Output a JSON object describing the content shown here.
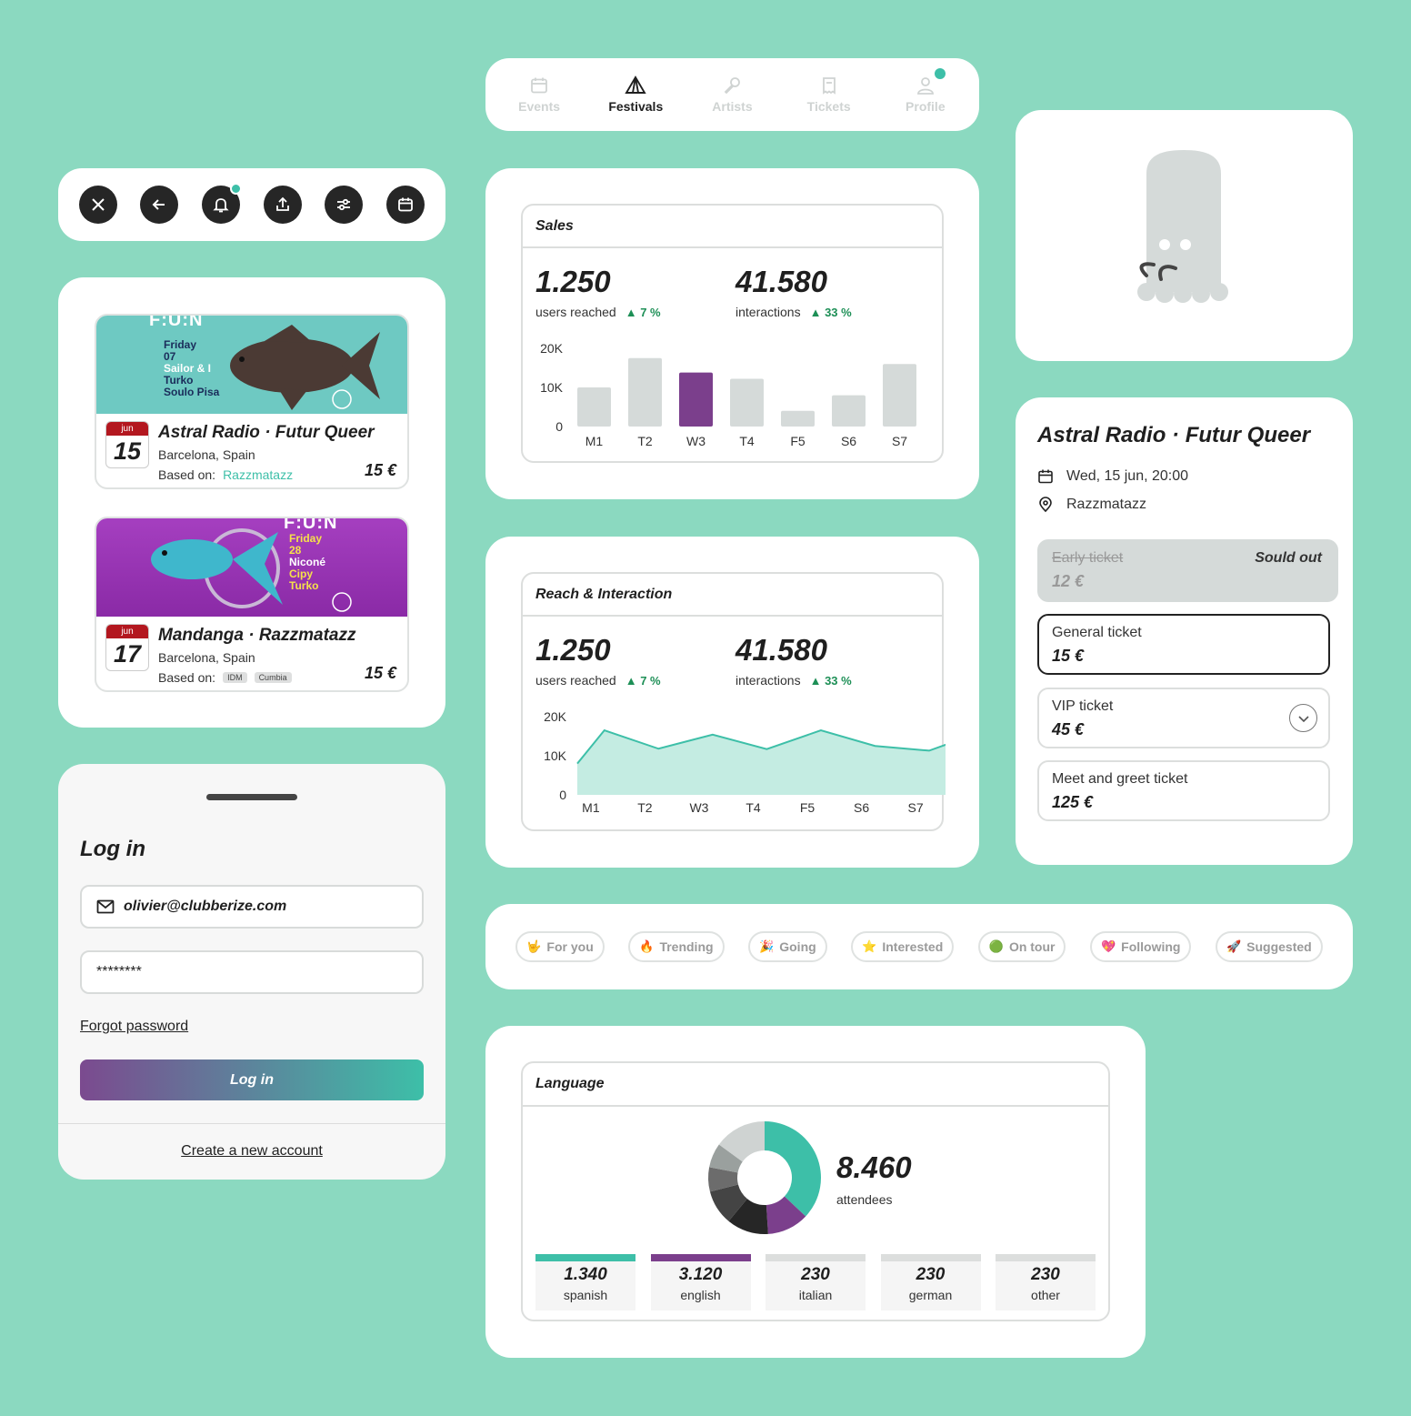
{
  "tabbar": {
    "tabs": [
      {
        "label": "Events",
        "icon": "calendar-icon",
        "active": false
      },
      {
        "label": "Festivals",
        "icon": "tent-icon",
        "active": true
      },
      {
        "label": "Artists",
        "icon": "microphone-icon",
        "active": false
      },
      {
        "label": "Tickets",
        "icon": "ticket-icon",
        "active": false
      },
      {
        "label": "Profile",
        "icon": "user-icon",
        "active": false
      }
    ]
  },
  "toolbar": {
    "icons": [
      "close-icon",
      "back-arrow-icon",
      "bell-icon",
      "share-upload-icon",
      "filters-icon",
      "calendar-icon"
    ]
  },
  "events": [
    {
      "poster_brand": "F:U:N",
      "poster_lines": [
        "Friday",
        "07",
        "Sailor & I",
        "Turko",
        "Soulo Pisa"
      ],
      "month": "jun",
      "day": "15",
      "title": "Astral Radio · Futur Queer",
      "city": "Barcelona, Spain",
      "based_label": "Based on:",
      "venue": "Razzmatazz",
      "tags": [],
      "price": "15 €"
    },
    {
      "poster_brand": "F:U:N",
      "poster_lines": [
        "Friday",
        "28",
        "Niconé",
        "Cipy",
        "Turko"
      ],
      "month": "jun",
      "day": "17",
      "title": "Mandanga · Razzmatazz",
      "city": "Barcelona, Spain",
      "based_label": "Based on:",
      "venue": "",
      "tags": [
        "IDM",
        "Cumbia"
      ],
      "price": "15 €"
    }
  ],
  "login": {
    "title": "Log in",
    "email_value": "olivier@clubberize.com",
    "password_value": "********",
    "forgot": "Forgot password",
    "button": "Log in",
    "create": "Create a new account"
  },
  "sales": {
    "title": "Sales",
    "stat1": {
      "value": "1.250",
      "label": "users reached",
      "delta": "7 %"
    },
    "stat2": {
      "value": "41.580",
      "label": "interactions",
      "delta": "33 %"
    }
  },
  "reach": {
    "title": "Reach & Interaction",
    "stat1": {
      "value": "1.250",
      "label": "users reached",
      "delta": "7 %"
    },
    "stat2": {
      "value": "41.580",
      "label": "interactions",
      "delta": "33 %"
    }
  },
  "ticket_panel": {
    "title": "Astral Radio · Futur Queer",
    "datetime": "Wed, 15 jun, 20:00",
    "venue": "Razzmatazz",
    "tickets": [
      {
        "name": "Early ticket",
        "price": "12 €",
        "status": "Sould out"
      },
      {
        "name": "General ticket",
        "price": "15 €"
      },
      {
        "name": "VIP ticket",
        "price": "45 €"
      },
      {
        "name": "Meet and greet ticket",
        "price": "125 €"
      }
    ]
  },
  "chips": [
    {
      "emoji": "🤟",
      "label": "For you"
    },
    {
      "emoji": "🔥",
      "label": "Trending"
    },
    {
      "emoji": "🎉",
      "label": "Going"
    },
    {
      "emoji": "⭐",
      "label": "Interested"
    },
    {
      "emoji": "🟢",
      "label": "On tour"
    },
    {
      "emoji": "💖",
      "label": "Following"
    },
    {
      "emoji": "🚀",
      "label": "Suggested"
    }
  ],
  "language": {
    "title": "Language",
    "total": "8.460",
    "total_label": "attendees",
    "items": [
      {
        "value": "1.340",
        "label": "spanish",
        "color": "#3dbfa8"
      },
      {
        "value": "3.120",
        "label": "english",
        "color": "#7b3f8c"
      },
      {
        "value": "230",
        "label": "italian",
        "color": "#dcdedd"
      },
      {
        "value": "230",
        "label": "german",
        "color": "#dcdedd"
      },
      {
        "value": "230",
        "label": "other",
        "color": "#dcdedd"
      }
    ]
  },
  "chart_data": [
    {
      "type": "bar",
      "title": "Sales",
      "categories": [
        "M1",
        "T2",
        "W3",
        "T4",
        "F5",
        "S6",
        "S7"
      ],
      "values": [
        10000,
        17500,
        13800,
        12200,
        4000,
        8000,
        16000
      ],
      "highlight": "W3",
      "yticks": [
        "0",
        "10K",
        "20K"
      ],
      "ylim": [
        0,
        20000
      ],
      "colors": {
        "bar": "#d5dad9",
        "highlight": "#7b3f8c"
      }
    },
    {
      "type": "area",
      "title": "Reach & Interaction",
      "categories": [
        "M1",
        "T2",
        "W3",
        "T4",
        "F5",
        "S6",
        "S7"
      ],
      "points_x": [
        0,
        0.5,
        1.5,
        2.5,
        3.5,
        4.5,
        5.5,
        6.5,
        7
      ],
      "values": [
        8000,
        16500,
        11800,
        15400,
        11700,
        16500,
        12500,
        11300,
        13800
      ],
      "yticks": [
        "0",
        "10K",
        "20K"
      ],
      "ylim": [
        0,
        20000
      ],
      "colors": {
        "line": "#3dbfa8",
        "fill": "#c4ece2"
      }
    },
    {
      "type": "pie",
      "title": "Language",
      "slices": [
        {
          "label": "spanish",
          "value": 1340,
          "color": "#3dbfa8"
        },
        {
          "label": "english",
          "value": 3120,
          "color": "#7b3f8c"
        },
        {
          "label": "italian",
          "value": 230,
          "color": "#dcdedd"
        },
        {
          "label": "german",
          "value": 230,
          "color": "#dcdedd"
        },
        {
          "label": "other",
          "value": 230,
          "color": "#dcdedd"
        }
      ],
      "rendered_segments": [
        {
          "color": "#3dbfa8",
          "value": 0.37
        },
        {
          "color": "#7b3f8c",
          "value": 0.12
        },
        {
          "color": "#262626",
          "value": 0.12
        },
        {
          "color": "#444444",
          "value": 0.1
        },
        {
          "color": "#6c6c6c",
          "value": 0.07
        },
        {
          "color": "#9aa09e",
          "value": 0.07
        },
        {
          "color": "#cfd3d2",
          "value": 0.15
        }
      ]
    }
  ]
}
